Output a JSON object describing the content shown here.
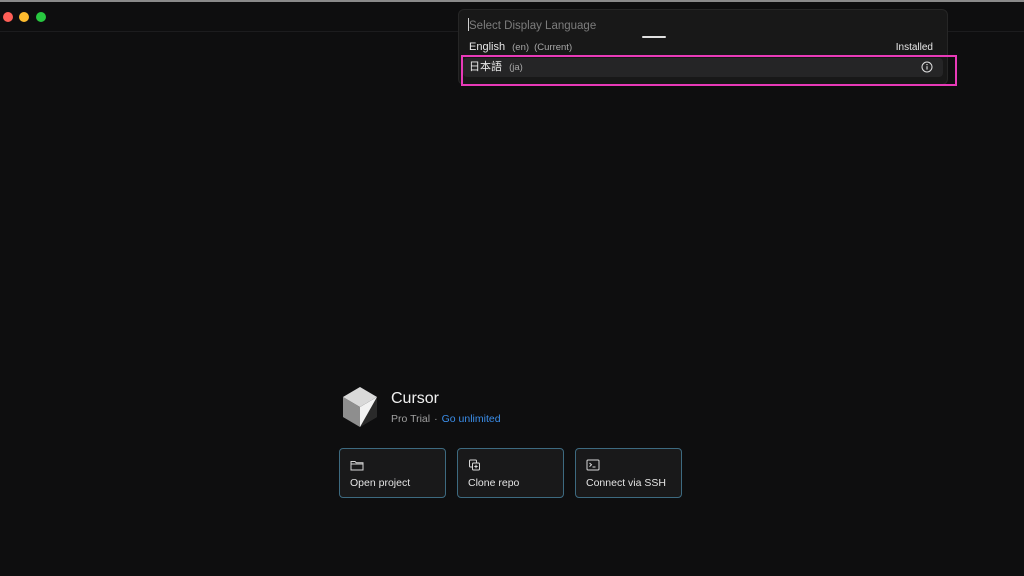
{
  "palette": {
    "placeholder": "Select Display Language",
    "options": [
      {
        "label": "English",
        "code": "(en)",
        "note": "(Current)",
        "status": "Installed"
      },
      {
        "label": "日本語",
        "code": "(ja)",
        "icon": "info-icon"
      }
    ]
  },
  "app": {
    "name": "Cursor",
    "plan": "Pro Trial",
    "separator": "·",
    "upgrade_link": "Go unlimited"
  },
  "actions": [
    {
      "label": "Open project",
      "icon": "folder-icon"
    },
    {
      "label": "Clone repo",
      "icon": "clone-icon"
    },
    {
      "label": "Connect via SSH",
      "icon": "terminal-icon"
    }
  ],
  "colors": {
    "accent_link": "#3b8eea",
    "highlight": "#e83ab8",
    "card_border": "#3d6a80"
  }
}
